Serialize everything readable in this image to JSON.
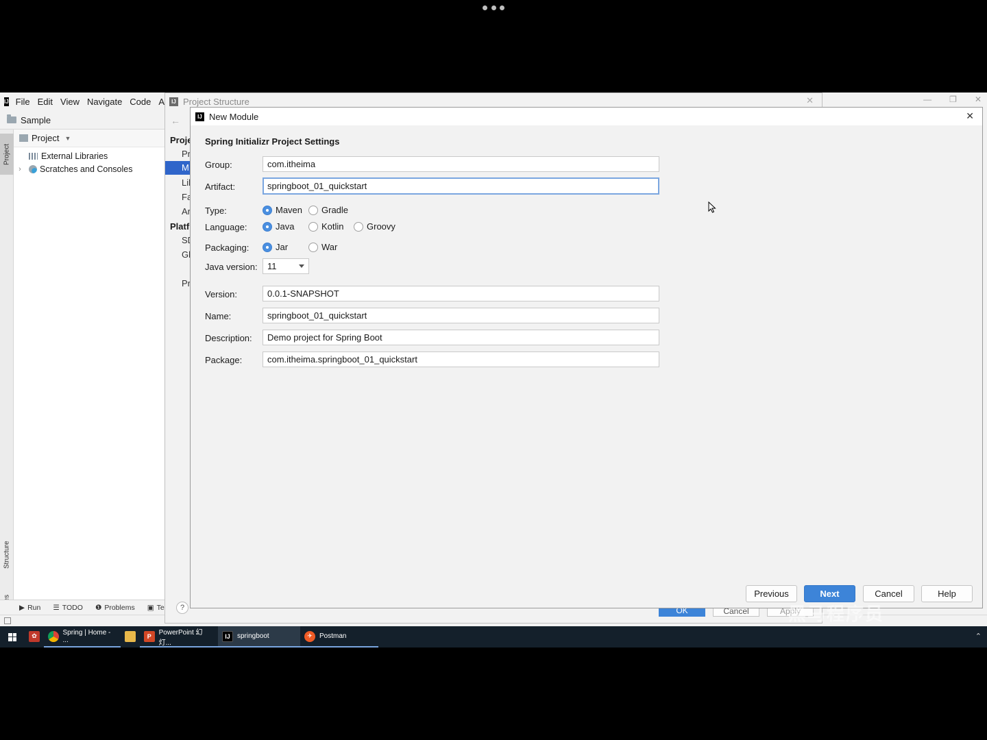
{
  "ide": {
    "menu": [
      "File",
      "Edit",
      "View",
      "Navigate",
      "Code",
      "A"
    ],
    "project_name": "Sample",
    "panel_title": "Project",
    "tree": [
      "External Libraries",
      "Scratches and Consoles"
    ],
    "strip_tabs": [
      "Project",
      "Structure",
      "Favorites"
    ],
    "bottom_tools": [
      "Run",
      "TODO",
      "Problems",
      "Te"
    ]
  },
  "project_structure": {
    "title": "Project Structure",
    "sections": [
      "Proje",
      "Platfi"
    ],
    "items": [
      "Pr",
      "M",
      "Lib",
      "Fa",
      "Ar",
      "SD",
      "Gl",
      "Pr"
    ],
    "selected_item": "M",
    "buttons": [
      "OK",
      "Cancel",
      "Apply"
    ]
  },
  "new_module": {
    "title": "New Module",
    "heading": "Spring Initializr Project Settings",
    "group_label": "Group:",
    "group_value": "com.itheima",
    "artifact_label": "Artifact:",
    "artifact_value": "springboot_01_quickstart",
    "type_label": "Type:",
    "type_options": [
      "Maven",
      "Gradle"
    ],
    "type_selected": "Maven",
    "language_label": "Language:",
    "language_options": [
      "Java",
      "Kotlin",
      "Groovy"
    ],
    "language_selected": "Java",
    "packaging_label": "Packaging:",
    "packaging_options": [
      "Jar",
      "War"
    ],
    "packaging_selected": "Jar",
    "java_version_label": "Java version:",
    "java_version_value": "11",
    "version_label": "Version:",
    "version_value": "0.0.1-SNAPSHOT",
    "name_label": "Name:",
    "name_value": "springboot_01_quickstart",
    "description_label": "Description:",
    "description_value": "Demo project for Spring Boot",
    "package_label": "Package:",
    "package_value": "com.itheima.springboot_01_quickstart",
    "buttons": {
      "previous": "Previous",
      "next": "Next",
      "cancel": "Cancel",
      "help": "Help"
    }
  },
  "taskbar": {
    "items": [
      "Spring | Home - ...",
      "PowerPoint 幻灯...",
      "springboot",
      "Postman"
    ],
    "active": "springboot"
  },
  "watermark": "黑马程序员",
  "colors": {
    "accent": "#3d84d8",
    "selection": "#2f65ca",
    "focus_border": "#7aa6e0",
    "taskbar": "#14202b"
  }
}
